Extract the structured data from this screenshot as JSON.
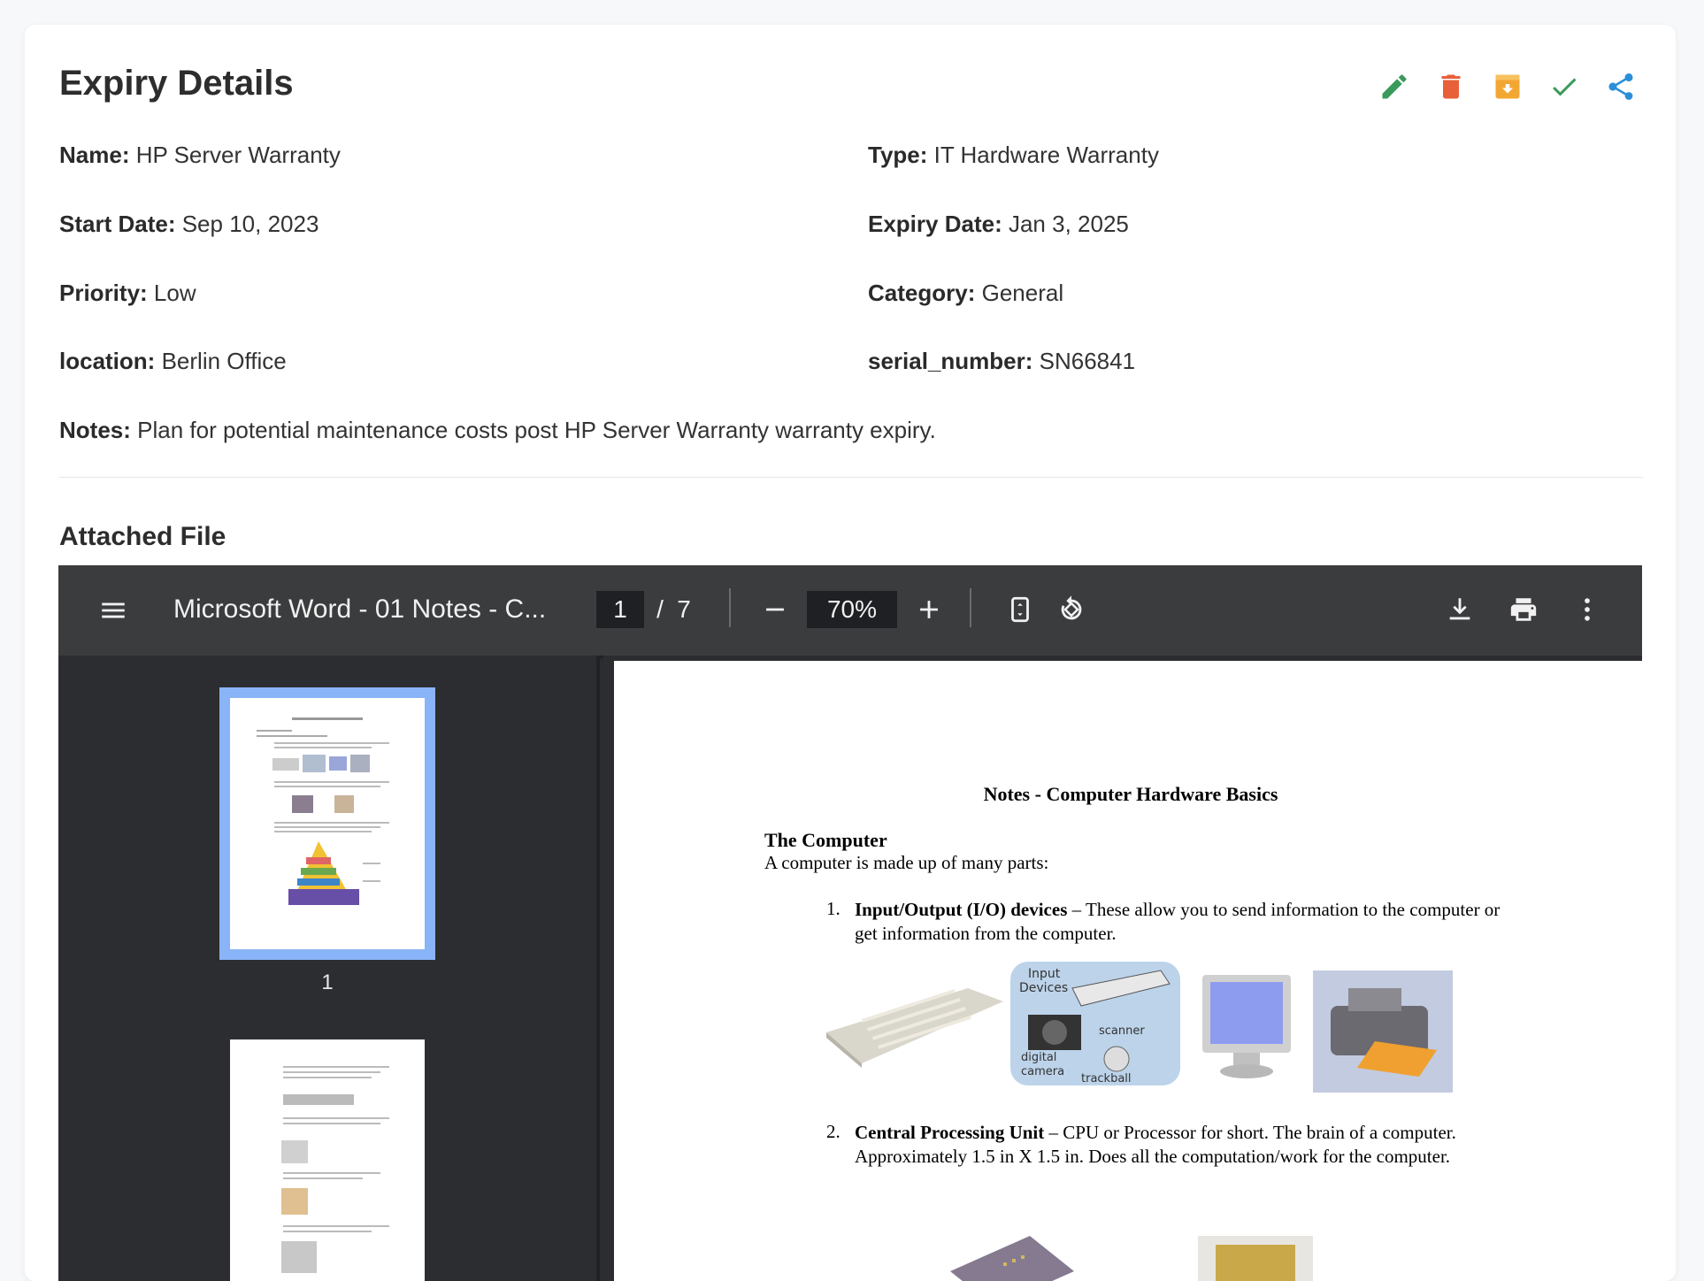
{
  "header": {
    "title": "Expiry Details",
    "actions": [
      {
        "name": "edit",
        "color": "#3a9a5b"
      },
      {
        "name": "delete",
        "color": "#e8603a"
      },
      {
        "name": "archive",
        "color": "#f3a733"
      },
      {
        "name": "complete",
        "color": "#3a9a5b"
      },
      {
        "name": "share",
        "color": "#2a8fd8"
      }
    ]
  },
  "fields": {
    "name_label": "Name:",
    "name_value": "HP Server Warranty",
    "type_label": "Type:",
    "type_value": "IT Hardware Warranty",
    "start_label": "Start Date:",
    "start_value": "Sep 10, 2023",
    "expiry_label": "Expiry Date:",
    "expiry_value": "Jan 3, 2025",
    "priority_label": "Priority:",
    "priority_value": "Low",
    "category_label": "Category:",
    "category_value": "General",
    "location_label": "location:",
    "location_value": "Berlin Office",
    "serial_label": "serial_number:",
    "serial_value": "SN66841",
    "notes_label": "Notes:",
    "notes_value": "Plan for potential maintenance costs post HP Server Warranty warranty expiry."
  },
  "attachment": {
    "heading": "Attached File",
    "viewer": {
      "doc_title": "Microsoft Word - 01 Notes - C...",
      "current_page": "1",
      "page_separator": "/",
      "total_pages": "7",
      "zoom": "70%",
      "thumbnail_label": "1"
    },
    "page_content": {
      "title": "Notes - Computer Hardware Basics",
      "subtitle": "The Computer",
      "intro": "A computer is made up of many parts:",
      "item1_num": "1.",
      "item1_bold": "Input/Output (I/O) devices",
      "item1_text": " – These allow you to send information to the computer or get information from the computer.",
      "item2_num": "2.",
      "item2_bold": "Central Processing Unit",
      "item2_text": " – CPU or Processor for short.  The brain of a computer.  Approximately 1.5 in X 1.5 in.  Does all the computation/work for the computer.",
      "img_labels": {
        "input": "Input",
        "devices": "Devices",
        "scanner": "scanner",
        "digital": "digital",
        "camera": "camera",
        "trackball": "trackball"
      }
    }
  }
}
